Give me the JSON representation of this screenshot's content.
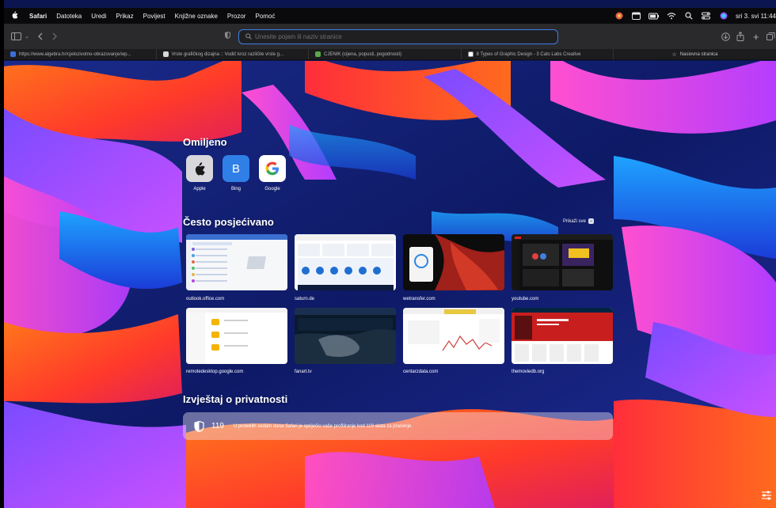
{
  "menubar": {
    "app": "Safari",
    "items": [
      "Datoteka",
      "Uredi",
      "Prikaz",
      "Povijest",
      "Knjižne oznake",
      "Prozor",
      "Pomoć"
    ],
    "clock": "sri 3. svi 11:44"
  },
  "toolbar": {
    "search_placeholder": "Unesite pojam ili naziv stranice"
  },
  "tabs": [
    {
      "label": "https://www.algebra.hr/cjelozivotno-obrazovanje/wp...",
      "color": "#3b6fd8"
    },
    {
      "label": "Vrste grafičkog dizajna :: Vodič kroz različite vrste g...",
      "color": "#d7d7d7"
    },
    {
      "label": "CJENIK (cijena, popusti, pogodnosti)",
      "color": "#5aa84a"
    },
    {
      "label": "8 Types of Graphic Design - 3 Cats Labs Creative",
      "color": "#ffffff"
    }
  ],
  "new_tab": {
    "label": "Nasiovna stranica"
  },
  "favorites": {
    "title": "Omiljeno",
    "items": [
      {
        "label": "Apple",
        "glyph": "",
        "icon": "apple-icon",
        "bg": "#dcdcdc",
        "fg": "#1a1a1a"
      },
      {
        "label": "Bing",
        "glyph": "B",
        "icon": "bing-icon",
        "bg": "#2f7fe6",
        "fg": "#ffffff"
      },
      {
        "label": "Google",
        "glyph": "G",
        "icon": "google-icon",
        "bg": "#ffffff",
        "fg": "#4285f4"
      }
    ]
  },
  "frequent": {
    "title": "Često posjećivano",
    "show_all": "Prikaži sve",
    "items": [
      {
        "label": "outlook.office.com"
      },
      {
        "label": "saturn.de"
      },
      {
        "label": "wetransfer.com"
      },
      {
        "label": "youtube.com"
      },
      {
        "label": "remotedesktop.google.com"
      },
      {
        "label": "fanart.tv"
      },
      {
        "label": "centarzdata.com"
      },
      {
        "label": "themoviedb.org"
      }
    ]
  },
  "privacy": {
    "title": "Izvještaj o privatnosti",
    "count": "119",
    "message": "U proteklih sedam dana Safari je spriječio vaše profiliranje kod 119 alata za praćenje."
  }
}
